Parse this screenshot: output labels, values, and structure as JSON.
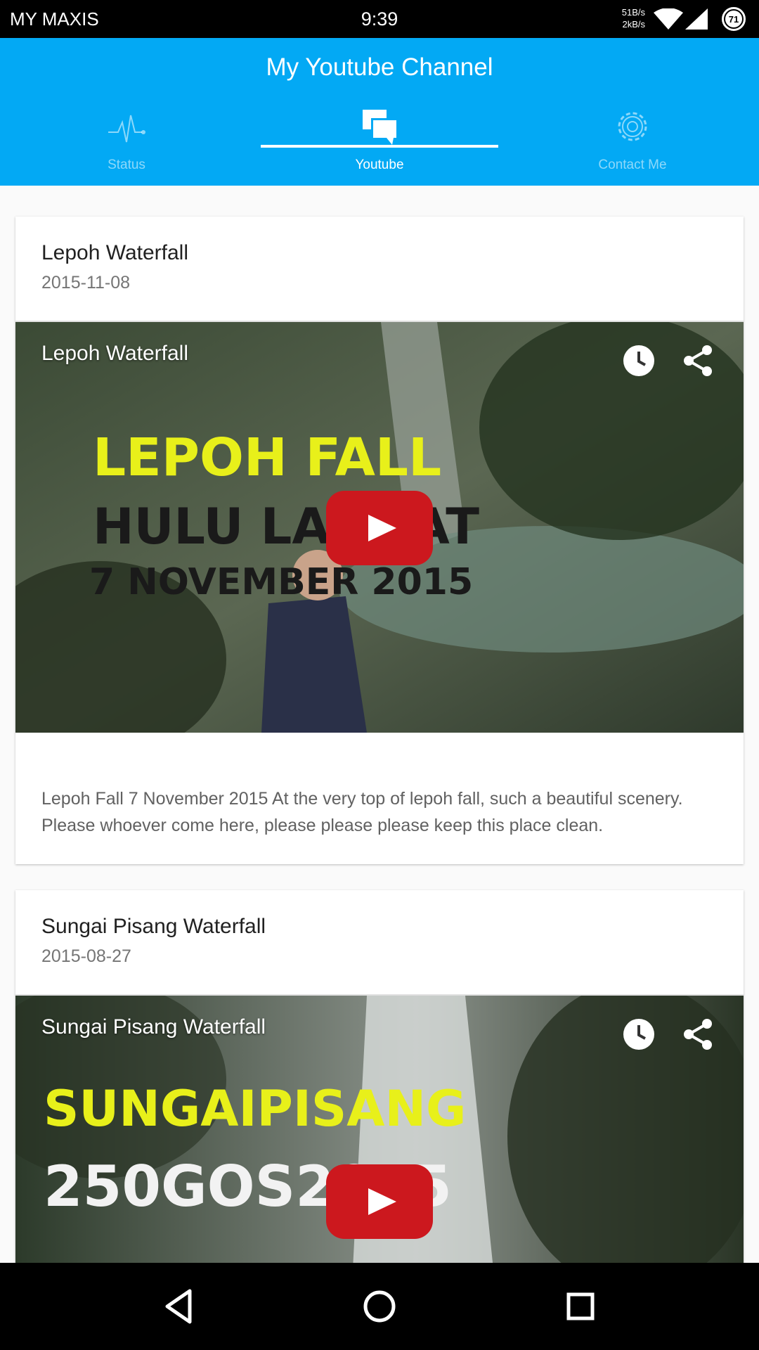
{
  "status_bar": {
    "carrier": "MY MAXIS",
    "time": "9:39",
    "speed_up": "51B/s",
    "speed_down": "2kB/s",
    "battery": "71"
  },
  "app": {
    "title": "My Youtube Channel",
    "accent_color": "#03a9f4"
  },
  "tabs": [
    {
      "label": "Status",
      "icon": "pulse-icon",
      "active": false
    },
    {
      "label": "Youtube",
      "icon": "chat-bubbles-icon",
      "active": true
    },
    {
      "label": "Contact Me",
      "icon": "gear-icon",
      "active": false
    }
  ],
  "videos": [
    {
      "title": "Lepoh Waterfall",
      "date": "2015-11-08",
      "thumb_title": "Lepoh Waterfall",
      "overlay_line1": "LEPOH FALL",
      "overlay_line2": "HULU LANGAT",
      "overlay_line3": "7 NOVEMBER 2015",
      "description": "Lepoh Fall 7 November 2015 At the very top of lepoh fall, such a beautiful scenery. Please whoever come here, please please please keep this place clean."
    },
    {
      "title": "Sungai Pisang Waterfall",
      "date": "2015-08-27",
      "thumb_title": "Sungai Pisang Waterfall",
      "overlay_line1": "SUNGAIPISANG",
      "overlay_line2": "250GOS2015"
    }
  ],
  "nav": {
    "back": "back-icon",
    "home": "home-icon",
    "recents": "recents-icon"
  }
}
